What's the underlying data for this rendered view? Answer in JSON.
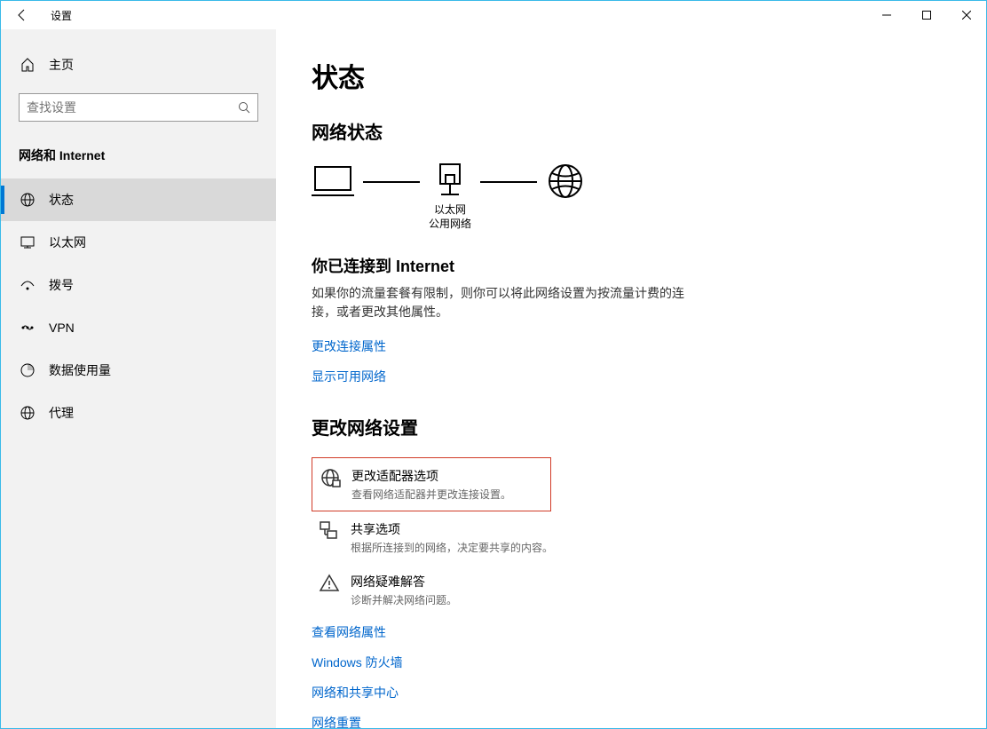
{
  "titlebar": {
    "title": "设置"
  },
  "sidebar": {
    "home_label": "主页",
    "search_placeholder": "查找设置",
    "section_label": "网络和 Internet",
    "items": [
      {
        "label": "状态"
      },
      {
        "label": "以太网"
      },
      {
        "label": "拨号"
      },
      {
        "label": "VPN"
      },
      {
        "label": "数据使用量"
      },
      {
        "label": "代理"
      }
    ]
  },
  "main": {
    "heading": "状态",
    "network_status_heading": "网络状态",
    "diagram": {
      "ethernet_label": "以太网",
      "network_type": "公用网络"
    },
    "connected_heading": "你已连接到 Internet",
    "connected_desc": "如果你的流量套餐有限制，则你可以将此网络设置为按流量计费的连接，或者更改其他属性。",
    "change_props_link": "更改连接属性",
    "show_networks_link": "显示可用网络",
    "change_settings_heading": "更改网络设置",
    "options": [
      {
        "title": "更改适配器选项",
        "sub": "查看网络适配器并更改连接设置。"
      },
      {
        "title": "共享选项",
        "sub": "根据所连接到的网络，决定要共享的内容。"
      },
      {
        "title": "网络疑难解答",
        "sub": "诊断并解决网络问题。"
      }
    ],
    "links": [
      "查看网络属性",
      "Windows 防火墙",
      "网络和共享中心",
      "网络重置"
    ]
  }
}
